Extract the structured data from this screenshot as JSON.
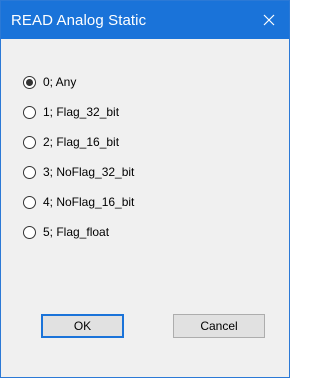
{
  "window": {
    "title": "READ Analog Static",
    "close_icon": "close-icon"
  },
  "options": [
    {
      "label": "0; Any",
      "checked": true
    },
    {
      "label": "1; Flag_32_bit",
      "checked": false
    },
    {
      "label": "2; Flag_16_bit",
      "checked": false
    },
    {
      "label": "3; NoFlag_32_bit",
      "checked": false
    },
    {
      "label": "4; NoFlag_16_bit",
      "checked": false
    },
    {
      "label": "5; Flag_float",
      "checked": false
    }
  ],
  "buttons": {
    "ok_label": "OK",
    "cancel_label": "Cancel"
  },
  "colors": {
    "titlebar": "#1a73d9",
    "dialog_bg": "#f0f0f0"
  }
}
